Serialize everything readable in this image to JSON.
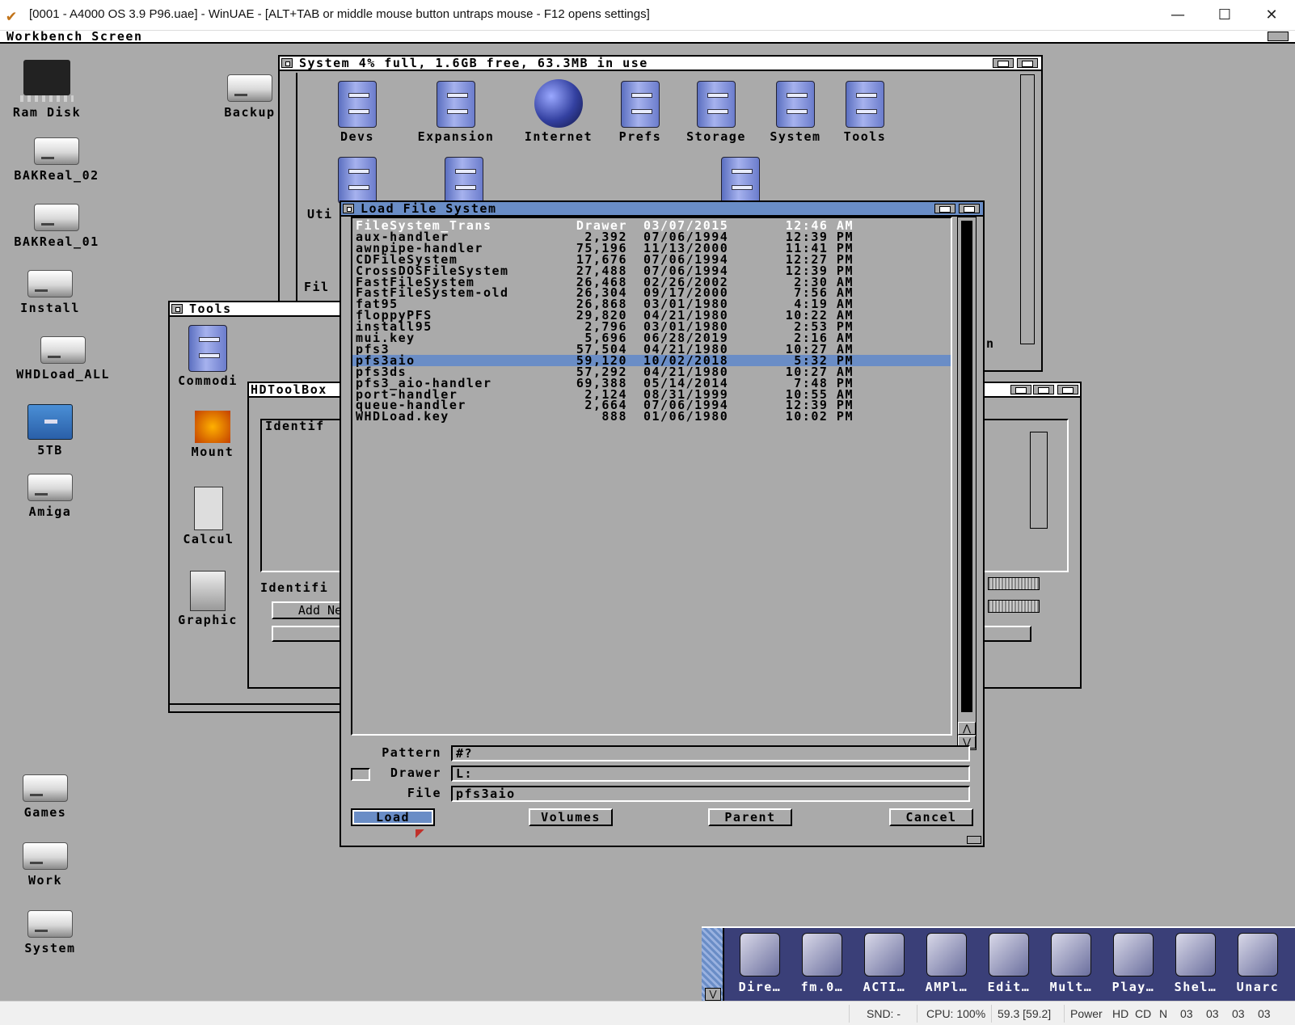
{
  "host": {
    "title": "[0001 - A4000 OS 3.9 P96.uae] - WinUAE - [ALT+TAB or middle mouse button untraps mouse - F12 opens settings]",
    "icon": "check-icon",
    "minimize": "—",
    "maximize": "☐",
    "close": "✕",
    "status": {
      "snd": "SND: -",
      "cpu": "CPU: 100%",
      "fps": "59.3 [59.2]",
      "power": "Power",
      "hd": "HD",
      "cd": "CD",
      "n": "N",
      "d0": "03",
      "d1": "03",
      "d2": "03",
      "d3": "03"
    }
  },
  "screen": {
    "title": "Workbench Screen"
  },
  "desktop_icons": [
    {
      "label": "Ram Disk",
      "icon": "chip-icon"
    },
    {
      "label": "BAKReal_02",
      "icon": "harddisk-icon"
    },
    {
      "label": "BAKReal_01",
      "icon": "harddisk-icon"
    },
    {
      "label": "Install",
      "icon": "harddisk-icon"
    },
    {
      "label": "WHDLoad_ALL",
      "icon": "harddisk-icon"
    },
    {
      "label": "5TB",
      "icon": "drawer-icon"
    },
    {
      "label": "Amiga",
      "icon": "harddisk-icon"
    },
    {
      "label": "Backup",
      "icon": "harddisk-icon"
    },
    {
      "label": "Games",
      "icon": "harddisk-icon"
    },
    {
      "label": "Work",
      "icon": "harddisk-icon"
    },
    {
      "label": "System",
      "icon": "harddisk-icon"
    }
  ],
  "system_window": {
    "title": "System  4% full, 1.6GB free, 63.3MB in use",
    "icons": [
      "Devs",
      "Expansion",
      "Internet",
      "Prefs",
      "Storage",
      "System",
      "Tools"
    ],
    "partial_labels": {
      "uti": "Uti",
      "fil": "Fil",
      "n": "n"
    }
  },
  "tools_window": {
    "title": "Tools",
    "partial_labels": [
      "Commodi",
      "Mount",
      "Calcul",
      "Graphic"
    ]
  },
  "hdtoolbox": {
    "title": "HDToolBox",
    "identify_tab": "Identif",
    "identify_label": "Identifi",
    "add_new": "Add Ne"
  },
  "requester": {
    "title": "Load File System",
    "files": [
      {
        "name": "FileSystem_Trans",
        "size": "Drawer",
        "date": "03/07/2015",
        "time": "12:46 AM"
      },
      {
        "name": "aux-handler",
        "size": "2,392",
        "date": "07/06/1994",
        "time": "12:39 PM"
      },
      {
        "name": "awnpipe-handler",
        "size": "75,196",
        "date": "11/13/2000",
        "time": "11:41 PM"
      },
      {
        "name": "CDFileSystem",
        "size": "17,676",
        "date": "07/06/1994",
        "time": "12:27 PM"
      },
      {
        "name": "CrossDOSFileSystem",
        "size": "27,488",
        "date": "07/06/1994",
        "time": "12:39 PM"
      },
      {
        "name": "FastFileSystem",
        "size": "26,468",
        "date": "02/26/2002",
        "time": "2:30 AM"
      },
      {
        "name": "FastFileSystem-old",
        "size": "26,304",
        "date": "09/17/2000",
        "time": "7:56 AM"
      },
      {
        "name": "fat95",
        "size": "26,868",
        "date": "03/01/1980",
        "time": "4:19 AM"
      },
      {
        "name": "floppyPFS",
        "size": "29,820",
        "date": "04/21/1980",
        "time": "10:22 AM"
      },
      {
        "name": "install95",
        "size": "2,796",
        "date": "03/01/1980",
        "time": "2:53 PM"
      },
      {
        "name": "mui.key",
        "size": "5,696",
        "date": "06/28/2019",
        "time": "2:16 AM"
      },
      {
        "name": "pfs3",
        "size": "57,504",
        "date": "04/21/1980",
        "time": "10:27 AM"
      },
      {
        "name": "pfs3aio",
        "size": "59,120",
        "date": "10/02/2018",
        "time": "5:32 PM"
      },
      {
        "name": "pfs3ds",
        "size": "57,292",
        "date": "04/21/1980",
        "time": "10:27 AM"
      },
      {
        "name": "pfs3_aio-handler",
        "size": "69,388",
        "date": "05/14/2014",
        "time": "7:48 PM"
      },
      {
        "name": "port-handler",
        "size": "2,124",
        "date": "08/31/1999",
        "time": "10:55 AM"
      },
      {
        "name": "queue-handler",
        "size": "2,664",
        "date": "07/06/1994",
        "time": "12:39 PM"
      },
      {
        "name": "WHDLoad.key",
        "size": "888",
        "date": "01/06/1980",
        "time": "10:02 PM"
      }
    ],
    "selected_index": 12,
    "pattern_label": "Pattern",
    "pattern_value": "#?",
    "drawer_label": "Drawer",
    "drawer_value": "L:",
    "file_label": "File",
    "file_value": "pfs3aio",
    "load_button": "Load",
    "volumes_button": "Volumes",
    "parent_button": "Parent",
    "cancel_button": "Cancel"
  },
  "dock": {
    "items": [
      "Dire…",
      "fm.0…",
      "ACTI…",
      "AMPl…",
      "Edit…",
      "Mult…",
      "Play…",
      "Shel…",
      "Unarc"
    ]
  }
}
